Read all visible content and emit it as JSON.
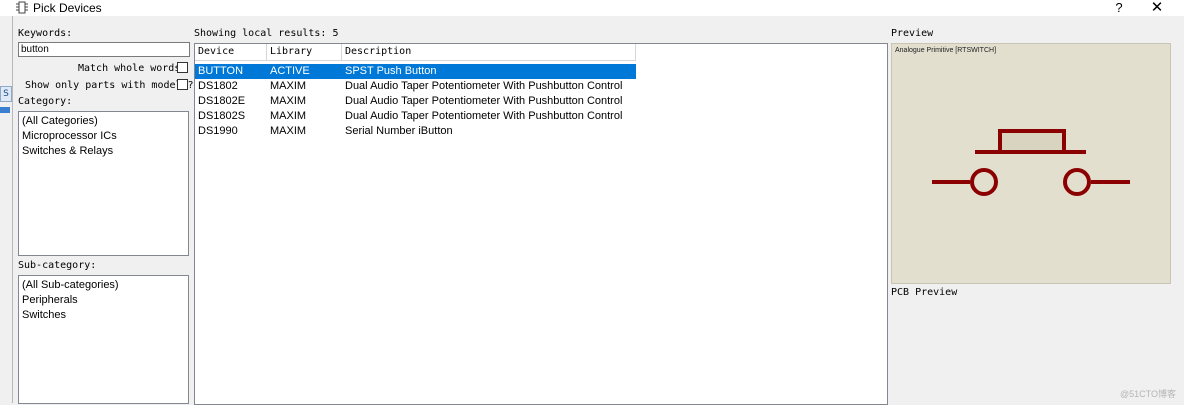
{
  "window": {
    "title": "Pick Devices",
    "help": "?",
    "close": "✕"
  },
  "left_strip": {
    "tab_label": "S"
  },
  "search": {
    "keywords_label": "Keywords:",
    "keywords_value": "button",
    "match_whole_words_label": "Match whole words?",
    "match_whole_words_checked": false,
    "only_models_label": "Show only parts with models?",
    "only_models_checked": false
  },
  "category": {
    "label": "Category:",
    "items": [
      "(All Categories)",
      "Microprocessor ICs",
      "Switches & Relays"
    ]
  },
  "subcategory": {
    "label": "Sub-category:",
    "items": [
      "(All Sub-categories)",
      "Peripherals",
      "Switches"
    ]
  },
  "results": {
    "status": "Showing local results: 5",
    "columns": [
      "Device",
      "Library",
      "Description"
    ],
    "rows": [
      {
        "device": "BUTTON",
        "library": "ACTIVE",
        "description": "SPST Push Button",
        "selected": true
      },
      {
        "device": "DS1802",
        "library": "MAXIM",
        "description": "Dual Audio Taper Potentiometer With Pushbutton Control",
        "selected": false
      },
      {
        "device": "DS1802E",
        "library": "MAXIM",
        "description": "Dual Audio Taper Potentiometer With Pushbutton Control",
        "selected": false
      },
      {
        "device": "DS1802S",
        "library": "MAXIM",
        "description": "Dual Audio Taper Potentiometer With Pushbutton Control",
        "selected": false
      },
      {
        "device": "DS1990",
        "library": "MAXIM",
        "description": "Serial Number iButton",
        "selected": false
      }
    ]
  },
  "preview": {
    "label": "Preview",
    "component_title": "Analogue Primitive [RTSWITCH]",
    "symbol_color": "#8b0000",
    "plunger_fill": "#d8d4c0",
    "pcb_label": "PCB Preview"
  },
  "colors": {
    "selection": "#0078d7",
    "preview_bg": "#e2dfcf"
  },
  "watermark": "@51CTO博客"
}
